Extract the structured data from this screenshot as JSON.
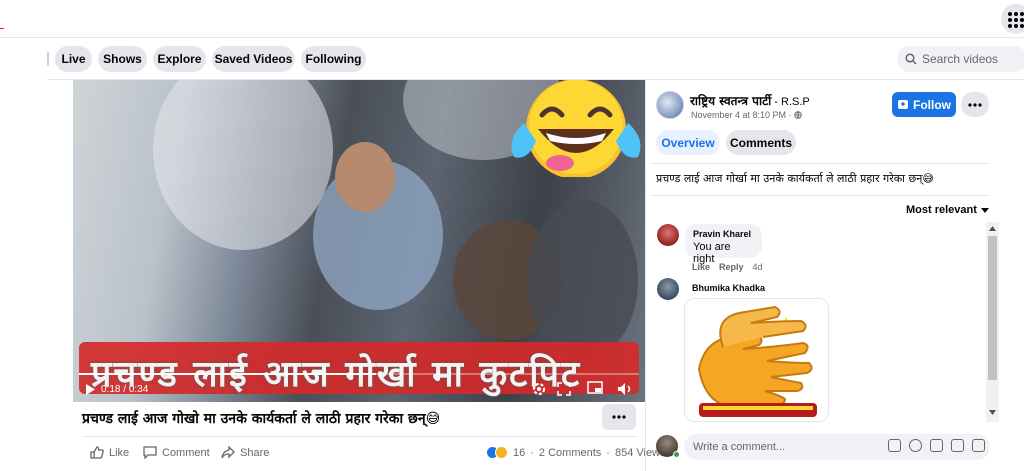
{
  "nav": {
    "tabs": [
      "Live",
      "Shows",
      "Explore",
      "Saved Videos",
      "Following"
    ],
    "search_placeholder": "Search videos"
  },
  "video": {
    "caption_overlay": "प्रचण्ड लाई आज गोर्खा मा कुटपिट",
    "time_current": "0:18",
    "time_total": "0:34",
    "progress": 0.53,
    "title": "प्रचण्ड लाई आज गोखो मा उनके कार्यकर्ता ले लाठी प्रहार गरेका छन्😅",
    "actions": {
      "like": "Like",
      "comment": "Comment",
      "share": "Share"
    },
    "stats": {
      "reactions": "16",
      "comments": "2 Comments",
      "views": "854 Views"
    }
  },
  "post": {
    "page_name": "राष्ट्रिय स्वतन्त्र पार्टी",
    "page_suffix": " - R.S.P",
    "time": "November 4 at 8:10 PM · ",
    "follow_label": "Follow",
    "tabs": [
      "Overview",
      "Comments"
    ],
    "description": "प्रचण्ड लाई आज गोर्खा मा उनके कार्यकर्ता ले लाठी प्रहार गरेका छन्😅",
    "sort_label": "Most relevant"
  },
  "comments": [
    {
      "author": "Pravin Kharel",
      "text": "You are right",
      "like": "Like",
      "reply": "Reply",
      "age": "4d"
    },
    {
      "author": "Bhumika Khadka",
      "sticker": "clapping-hands"
    }
  ],
  "composer": {
    "placeholder": "Write a comment..."
  },
  "colors": {
    "accent": "#1b74e4",
    "caption_red": "#d42a2a",
    "online": "#31a24c"
  }
}
